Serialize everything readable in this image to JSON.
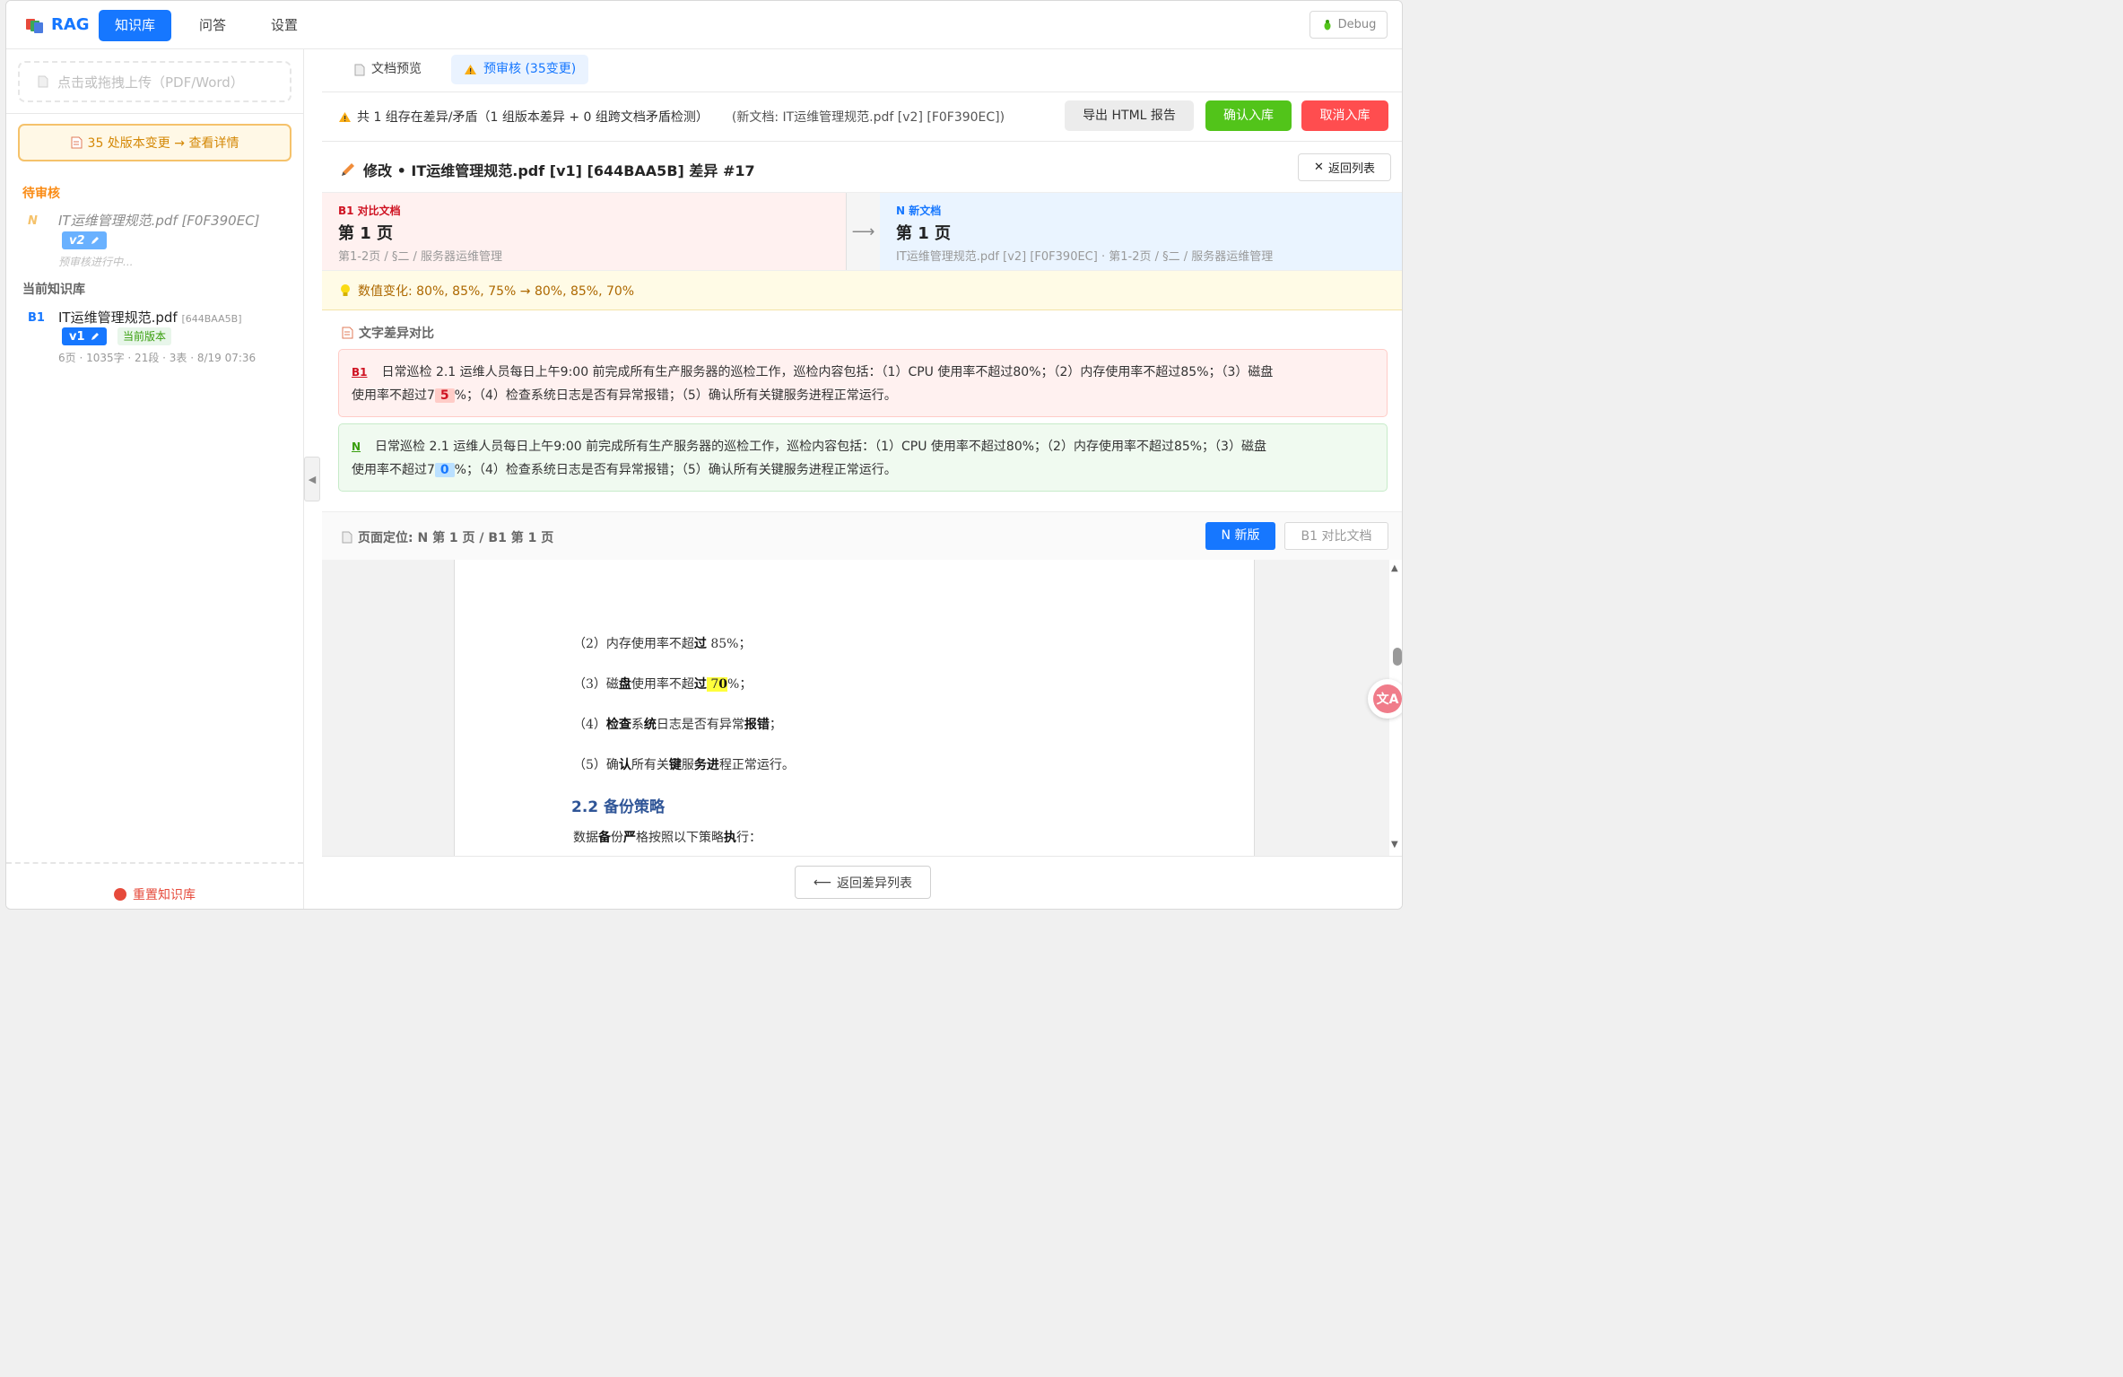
{
  "app": {
    "logo_text": "RAG",
    "nav": [
      "知识库",
      "问答",
      "设置"
    ],
    "debug_label": "Debug"
  },
  "sidebar": {
    "upload_placeholder": "点击或拖拽上传（PDF/Word）",
    "changes_button": "35 处版本变更 → 查看详情",
    "pending_title": "待审核",
    "pending_doc": {
      "tag": "N",
      "name": "IT运维管理规范.pdf [F0F390EC]",
      "version": "v2",
      "status": "预审核进行中..."
    },
    "current_title": "当前知识库",
    "current_doc": {
      "tag": "B1",
      "name": "IT运维管理规范.pdf",
      "hash": "[644BAA5B]",
      "version": "v1",
      "badge": "当前版本",
      "meta": "6页 · 1035字 · 21段 · 3表 · 8/19 07:36"
    },
    "reset_label": "重置知识库"
  },
  "main": {
    "tabs": [
      {
        "label": "文档预览"
      },
      {
        "label": "预审核 (35变更)"
      }
    ],
    "summary": {
      "text": "共 1 组存在差异/矛盾（1 组版本差异 + 0 组跨文档矛盾检测）",
      "new_doc": "(新文档: IT运维管理规范.pdf [v2] [F0F390EC])"
    },
    "actions": {
      "export": "导出 HTML 报告",
      "confirm": "确认入库",
      "cancel": "取消入库"
    },
    "diff": {
      "title": "修改 • IT运维管理规范.pdf [v1] [644BAA5B] 差异 #17",
      "back_list": "返回列表",
      "left": {
        "label": "B1 对比文档",
        "page": "第 1 页",
        "path": "第1-2页 / §二 / 服务器运维管理"
      },
      "right": {
        "label": "N 新文档",
        "page": "第 1 页",
        "path": "IT运维管理规范.pdf [v2] [F0F390EC] · 第1-2页 / §二 / 服务器运维管理"
      },
      "value_change": "数值变化: 80%, 85%, 75% → 80%, 85%, 70%",
      "text_diff_title": "文字差异对比",
      "old": {
        "tag": "B1",
        "line1": "日常巡检 2.1 运维人员每日上午9:00 前完成所有生产服务器的巡检工作，巡检内容包括：（1）CPU 使用率不超过80%；（2）内存使用率不超过85%；（3）磁盘",
        "prefix": "使用率不超过7",
        "changed": "5",
        "suffix": "%；（4）检查系统日志是否有异常报错；（5）确认所有关键服务进程正常运行。"
      },
      "new": {
        "tag": "N",
        "line1": "日常巡检 2.1 运维人员每日上午9:00 前完成所有生产服务器的巡检工作，巡检内容包括：（1）CPU 使用率不超过80%；（2）内存使用率不超过85%；（3）磁盘",
        "prefix": "使用率不超过7",
        "changed": "0",
        "suffix": "%；（4）检查系统日志是否有异常报错；（5）确认所有关键服务进程正常运行。"
      }
    },
    "locator": {
      "text": "页面定位: N 第 1 页 / B1 第 1 页",
      "new_btn": "N 新版",
      "b1_btn": "B1 对比文档"
    },
    "preview": {
      "l1a": "（2）内存使用率不超",
      "l1b": "过",
      "l1c": " 85%；",
      "l2a": "（3）磁",
      "l2b": "盘",
      "l2c": "使用率不超",
      "l2d": "过",
      "l2e": " 7",
      "l2f": "0",
      "l2g": "%；",
      "l3a": "（4）",
      "l3b": "检查",
      "l3c": "系",
      "l3d": "统",
      "l3e": "日志是否有异常",
      "l3f": "报错",
      "l3g": "；",
      "l4a": "（5）确",
      "l4b": "认",
      "l4c": "所有关",
      "l4d": "键",
      "l4e": "服",
      "l4f": "务进",
      "l4g": "程正常运行。",
      "heading": "2.2 备份策略",
      "l5a": "数据",
      "l5b": "备",
      "l5c": "份",
      "l5d": "严",
      "l5e": "格按照以下策略",
      "l5f": "执",
      "l5g": "行："
    },
    "back_diff": "返回差异列表"
  },
  "colors": {
    "accent": "#1677ff",
    "confirm": "#52c41a",
    "cancel": "#ff4d4f",
    "warning": "#d48806"
  }
}
